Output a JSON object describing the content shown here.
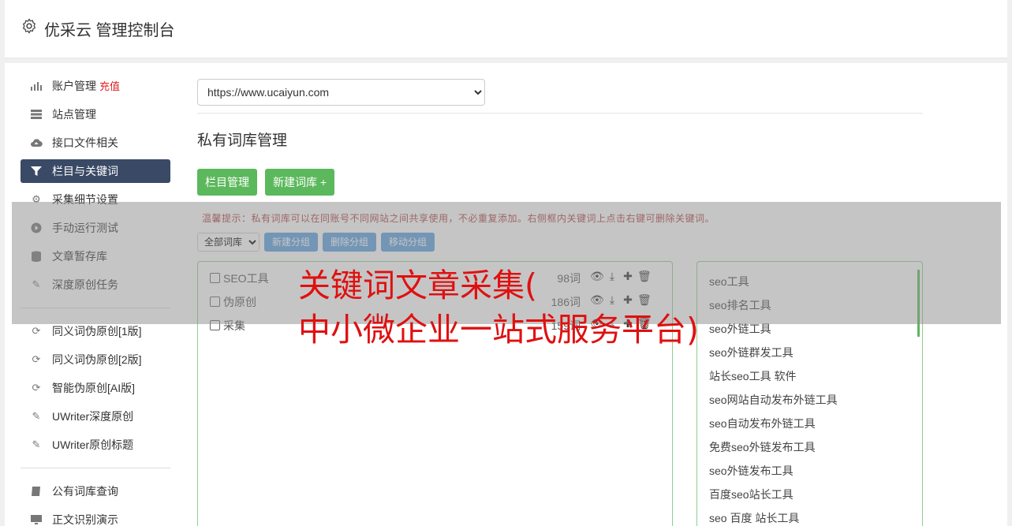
{
  "header": {
    "title": "优采云 管理控制台",
    "icon": "gear-icon"
  },
  "sidebar": {
    "group1": [
      {
        "label": "账户管理",
        "badge": "充值",
        "icon": "bar-chart-icon"
      },
      {
        "label": "站点管理",
        "icon": "server-icon"
      },
      {
        "label": "接口文件相关",
        "icon": "cloud-upload-icon"
      },
      {
        "label": "栏目与关键词",
        "icon": "filter-icon",
        "active": true
      },
      {
        "label": "采集细节设置",
        "icon": "cogs-icon"
      },
      {
        "label": "手动运行测试",
        "icon": "play-circle-icon"
      },
      {
        "label": "文章暂存库",
        "icon": "database-icon"
      },
      {
        "label": "深度原创任务",
        "icon": "edit-icon"
      }
    ],
    "group2": [
      {
        "label": "同义词伪原创[1版]",
        "icon": "refresh-icon"
      },
      {
        "label": "同义词伪原创[2版]",
        "icon": "refresh-icon"
      },
      {
        "label": "智能伪原创[AI版]",
        "icon": "refresh-icon"
      },
      {
        "label": "UWriter深度原创",
        "icon": "edit-icon"
      },
      {
        "label": "UWriter原创标题",
        "icon": "edit-icon"
      }
    ],
    "group3": [
      {
        "label": "公有词库查询",
        "icon": "book-icon"
      },
      {
        "label": "正文识别演示",
        "icon": "monitor-icon"
      }
    ]
  },
  "site_select": {
    "value": "https://www.ucaiyun.com"
  },
  "section_title": "私有词库管理",
  "buttons": {
    "column_manage": "栏目管理",
    "new_lexicon": "新建词库 +"
  },
  "tip": "温馨提示：私有词库可以在同账号不同网站之间共享使用，不必重复添加。右侧框内关键词上点击右键可删除关键词。",
  "tools": {
    "filter_value": "全部词库",
    "new_group": "新建分组",
    "delete_group": "删除分组",
    "move_group": "移动分组"
  },
  "lexicons": [
    {
      "name": "SEO工具",
      "count": "98词"
    },
    {
      "name": "伪原创",
      "count": "186词"
    },
    {
      "name": "采集",
      "count": "159词"
    }
  ],
  "keywords": [
    "seo工具",
    "seo排名工具",
    "seo外链工具",
    "seo外链群发工具",
    "站长seo工具 软件",
    "seo网站自动发布外链工具",
    "seo自动发布外链工具",
    "免费seo外链发布工具",
    "seo外链发布工具",
    "百度seo站长工具",
    "seo 百度 站长工具"
  ],
  "overlay": {
    "line1": "关键词文章采集(",
    "line2": "中小微企业一站式服务平台)"
  }
}
